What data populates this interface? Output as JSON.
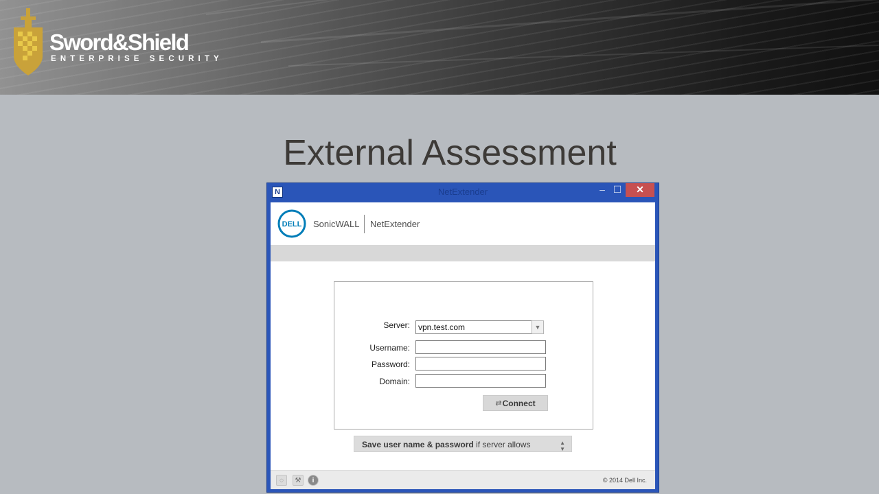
{
  "banner": {
    "brand_name": "Sword&Shield",
    "brand_tagline": "ENTERPRISE SECURITY"
  },
  "slide": {
    "title": "External Assessment"
  },
  "window": {
    "title": "NetExtender",
    "app_icon_letter": "N",
    "minimize_glyph": "–",
    "maximize_glyph": "☐",
    "close_glyph": "✕",
    "brand": {
      "logo_text": "DELL",
      "product_left": "SonicWALL",
      "product_right": "NetExtender"
    },
    "form": {
      "server_label": "Server:",
      "server_value": "vpn.test.com",
      "username_label": "Username:",
      "username_value": "",
      "password_label": "Password:",
      "password_value": "",
      "domain_label": "Domain:",
      "domain_value": "",
      "connect_label": "Connect",
      "connect_icon": "⇄"
    },
    "save_option": {
      "bold_part": "Save user name & password",
      "rest_part": " if server allows"
    },
    "status": {
      "copyright": "© 2014 Dell Inc."
    }
  },
  "colors": {
    "slide_background": "#b7bbc0",
    "window_frame": "#2a55b8",
    "close_button": "#c75050",
    "dell_blue": "#007db8",
    "shield_gold": "#c9a23a"
  }
}
